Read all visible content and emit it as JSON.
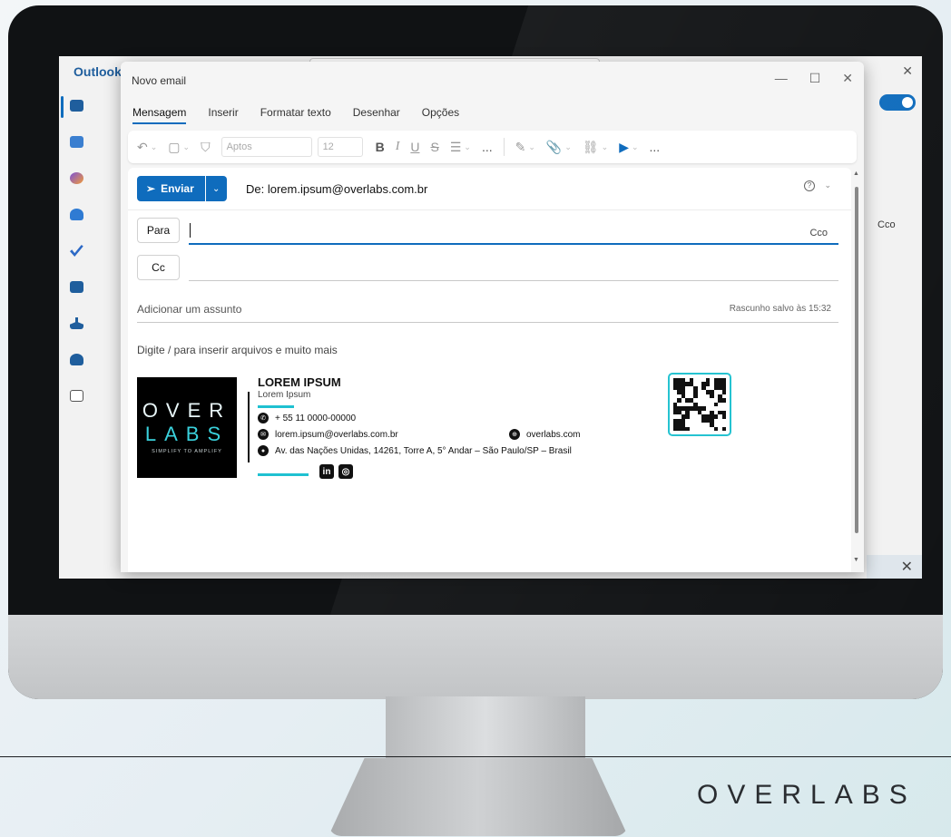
{
  "outer": {
    "brand": "OVERLABS"
  },
  "outlook": {
    "app_name": "Outlook",
    "right_cco": "Cco"
  },
  "compose": {
    "window_title": "Novo email",
    "tabs": [
      {
        "label": "Mensagem",
        "active": true
      },
      {
        "label": "Inserir",
        "active": false
      },
      {
        "label": "Formatar texto",
        "active": false
      },
      {
        "label": "Desenhar",
        "active": false
      },
      {
        "label": "Opções",
        "active": false
      }
    ],
    "ribbon": {
      "font_name": "Aptos",
      "font_size": "12",
      "more": "..."
    },
    "send_label": "Enviar",
    "from": "De: lorem.ipsum@overlabs.com.br",
    "to_label": "Para",
    "cc_label": "Cc",
    "bcc_link": "Cco",
    "subject_placeholder": "Adicionar um assunto",
    "draft_status": "Rascunho salvo às 15:32",
    "body_hint": "Digite / para inserir arquivos e muito mais"
  },
  "signature": {
    "logo_line1": "OVER",
    "logo_line2": "LABS",
    "logo_tagline": "SIMPLIFY TO AMPLIFY",
    "name": "LOREM IPSUM",
    "role": "Lorem Ipsum",
    "phone": "+ 55 11 0000-00000",
    "email": "lorem.ipsum@overlabs.com.br",
    "website": "overlabs.com",
    "address": "Av. das Nações Unidas, 14261, Torre A, 5° Andar – São Paulo/SP – Brasil"
  },
  "colors": {
    "accent": "#0f6cbd",
    "brand_cyan": "#1fc1d1"
  }
}
